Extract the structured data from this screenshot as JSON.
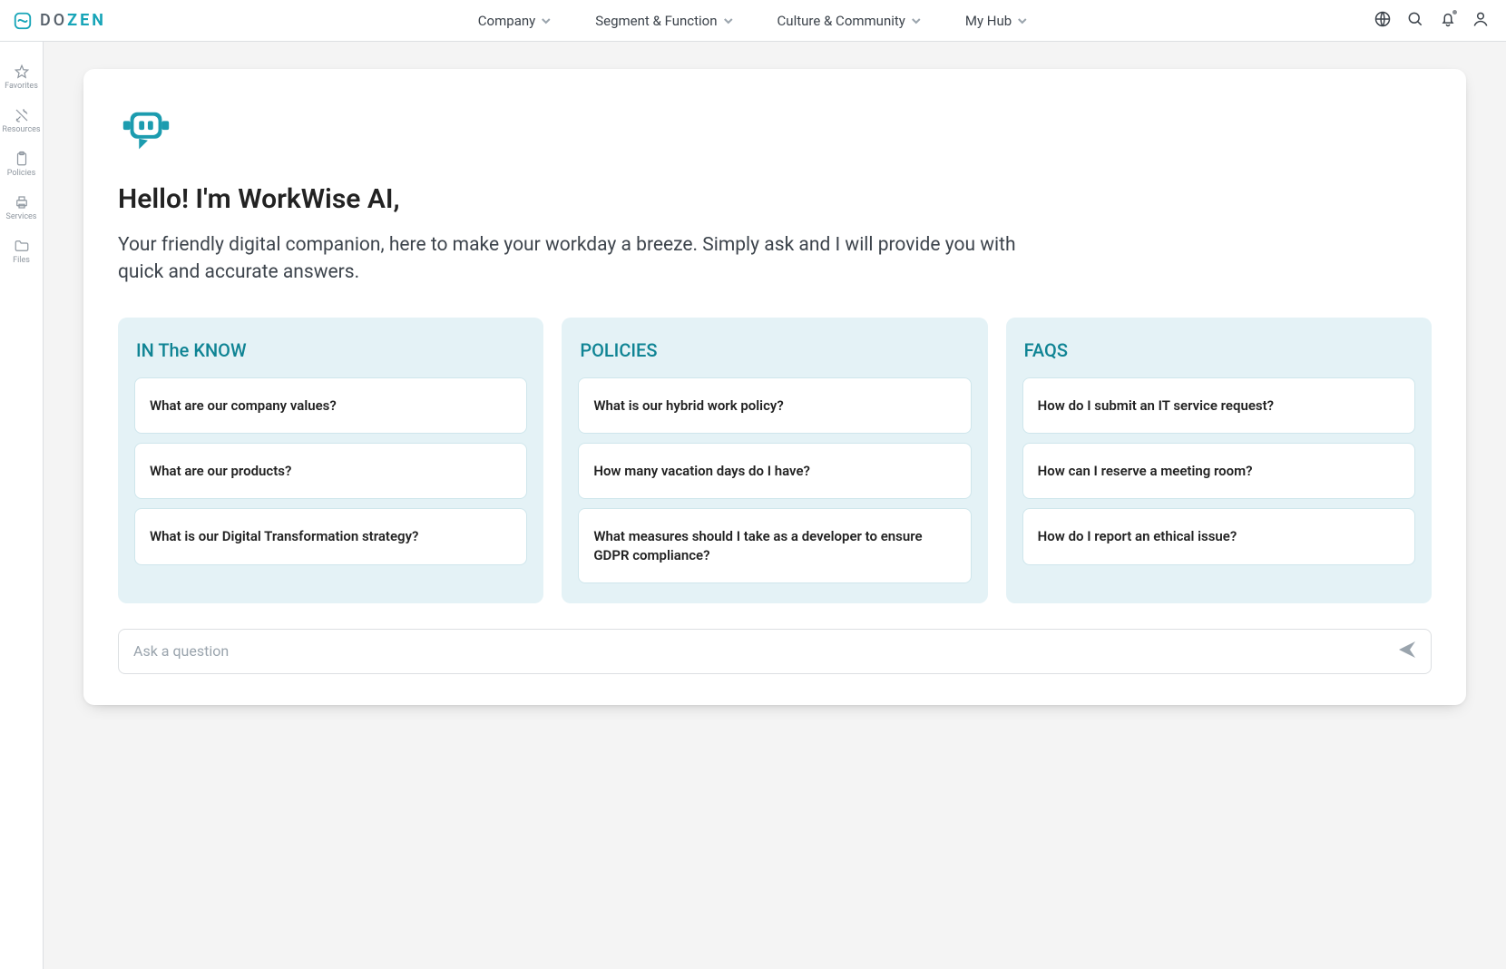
{
  "brand": {
    "text_left": "DO",
    "text_right": "ZEN"
  },
  "nav": {
    "company": "Company",
    "segment": "Segment & Function",
    "culture": "Culture & Community",
    "hub": "My Hub"
  },
  "sidebar": {
    "favorites": "Favorites",
    "resources": "Resources",
    "policies": "Policies",
    "services": "Services",
    "files": "Files"
  },
  "main": {
    "headline": "Hello! I'm WorkWise AI,",
    "subhead": "Your friendly digital companion, here to make your workday a breeze. Simply ask and I will provide you with quick and accurate answers."
  },
  "panels": {
    "know": {
      "title": "IN The KNOW",
      "q1": "What are our company values?",
      "q2": "What are our products?",
      "q3": "What is our Digital Transformation strategy?"
    },
    "policies": {
      "title": "POLICIES",
      "q1": "What is our hybrid work policy?",
      "q2": "How many vacation days do I have?",
      "q3": "What measures should I take as a developer to ensure GDPR compliance?"
    },
    "faqs": {
      "title": "FAQS",
      "q1": "How do I submit an IT service request?",
      "q2": "How can I reserve a meeting room?",
      "q3": "How do I report an ethical issue?"
    }
  },
  "ask": {
    "placeholder": "Ask a question"
  }
}
